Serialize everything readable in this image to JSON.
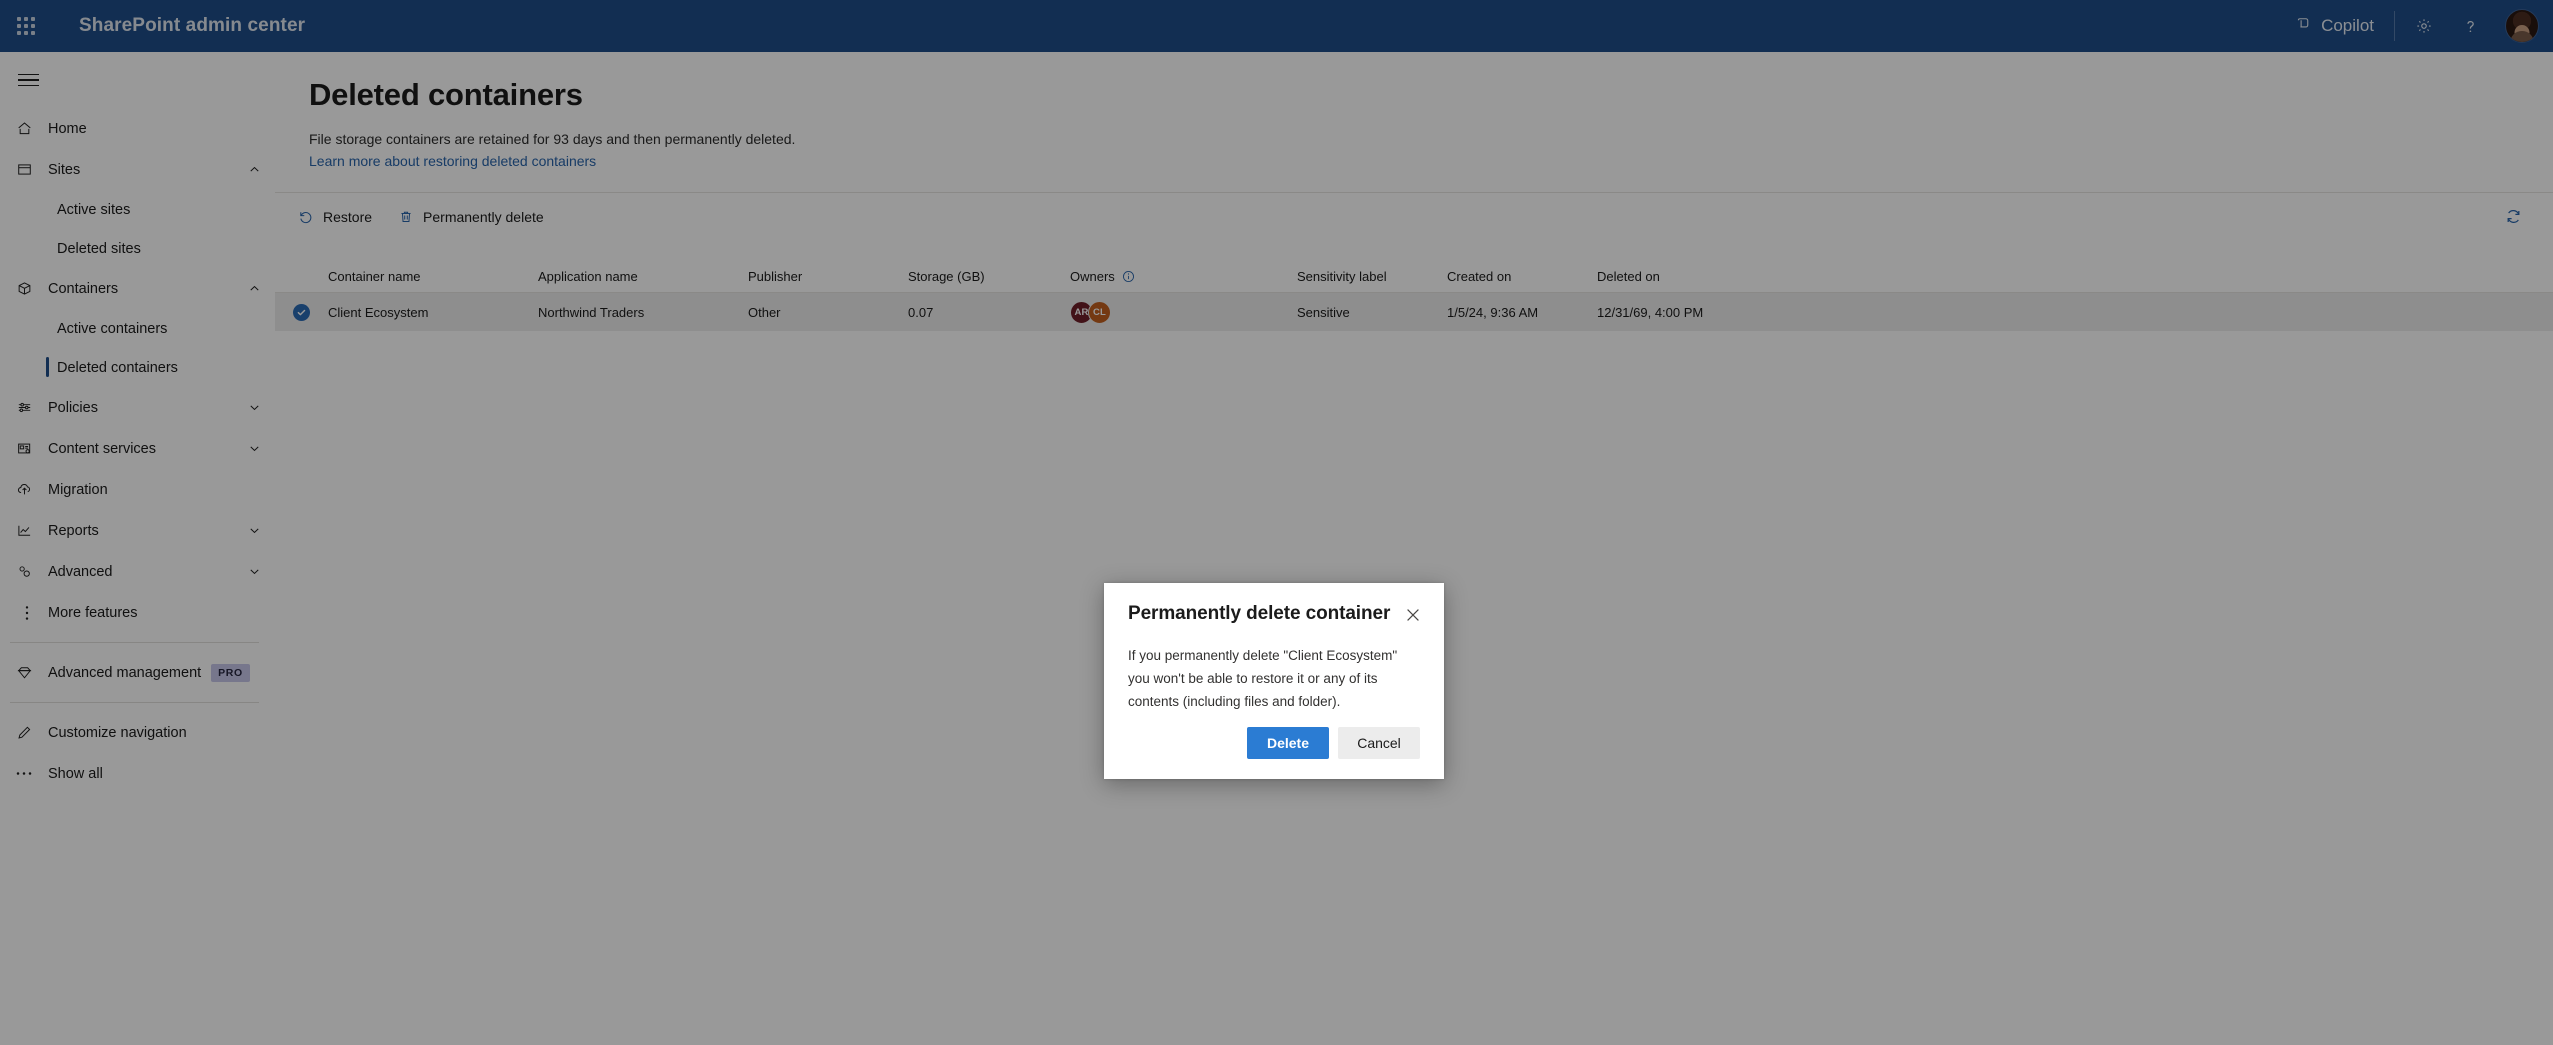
{
  "suite": {
    "waffle_label": "app-launcher",
    "title": "SharePoint admin center",
    "copilot_label": "Copilot",
    "settings_label": "Settings",
    "help_label": "Help",
    "account_label": "Account manager"
  },
  "sidebar": {
    "menu_toggle_label": "Global navigation toggle",
    "items": [
      {
        "label": "Home",
        "icon": "home-icon",
        "type": "item",
        "expand": "none"
      },
      {
        "label": "Sites",
        "icon": "sites-icon",
        "type": "item",
        "expand": "up"
      },
      {
        "label": "Active sites",
        "icon": "",
        "type": "sub",
        "selected": false
      },
      {
        "label": "Deleted sites",
        "icon": "",
        "type": "sub",
        "selected": false
      },
      {
        "label": "Containers",
        "icon": "containers-icon",
        "type": "item",
        "expand": "up"
      },
      {
        "label": "Active containers",
        "icon": "",
        "type": "sub",
        "selected": false
      },
      {
        "label": "Deleted containers",
        "icon": "",
        "type": "sub",
        "selected": true
      },
      {
        "label": "Policies",
        "icon": "policies-icon",
        "type": "item",
        "expand": "down"
      },
      {
        "label": "Content services",
        "icon": "content-services-icon",
        "type": "item",
        "expand": "down"
      },
      {
        "label": "Migration",
        "icon": "migration-icon",
        "type": "item",
        "expand": "none"
      },
      {
        "label": "Reports",
        "icon": "reports-icon",
        "type": "item",
        "expand": "down"
      },
      {
        "label": "Advanced",
        "icon": "advanced-icon",
        "type": "item",
        "expand": "down"
      },
      {
        "label": "More features",
        "icon": "more-features-icon",
        "type": "item",
        "expand": "none"
      },
      {
        "label": "Advanced management",
        "icon": "diamond-icon",
        "type": "item",
        "expand": "none",
        "badge": "PRO"
      },
      {
        "label": "Customize navigation",
        "icon": "pencil-icon",
        "type": "item",
        "expand": "none"
      },
      {
        "label": "Show all",
        "icon": "ellipsis-icon",
        "type": "item",
        "expand": "none"
      }
    ]
  },
  "page": {
    "title": "Deleted containers",
    "description": "File storage containers are retained for 93 days and then permanently deleted.",
    "link": "Learn more about restoring deleted containers"
  },
  "commandbar": {
    "restore_label": "Restore",
    "permanently_delete_label": "Permanently delete",
    "refresh_label": "Refresh"
  },
  "table": {
    "columns": [
      "Container name",
      "Application name",
      "Publisher",
      "Storage (GB)",
      "Owners",
      "Sensitivity label",
      "Created on",
      "Deleted on"
    ],
    "owners_info_tooltip": "Owners",
    "rows": [
      {
        "selected": true,
        "container_name": "Client Ecosystem",
        "application_name": "Northwind Traders",
        "publisher": "Other",
        "storage_gb": "0.07",
        "owners": [
          {
            "initials": "AR",
            "color": "#6e1f28"
          },
          {
            "initials": "CL",
            "color": "#c1601f"
          }
        ],
        "sensitivity_label": "Sensitive",
        "created_on": "1/5/24, 9:36 AM",
        "deleted_on": "12/31/69, 4:00 PM"
      }
    ]
  },
  "dialog": {
    "title": "Permanently delete container",
    "close_label": "Close",
    "body": "If you permanently delete \"Client Ecosystem\" you won't be able to restore it or any of its contents (including files and folder).",
    "primary_label": "Delete",
    "secondary_label": "Cancel"
  },
  "colors": {
    "suitebar": "#1f4e89",
    "accent": "#2864ab",
    "primary_button": "#2b7cd3",
    "selected_row": "#ededed",
    "nav_selected_bar": "#1f4e89"
  }
}
